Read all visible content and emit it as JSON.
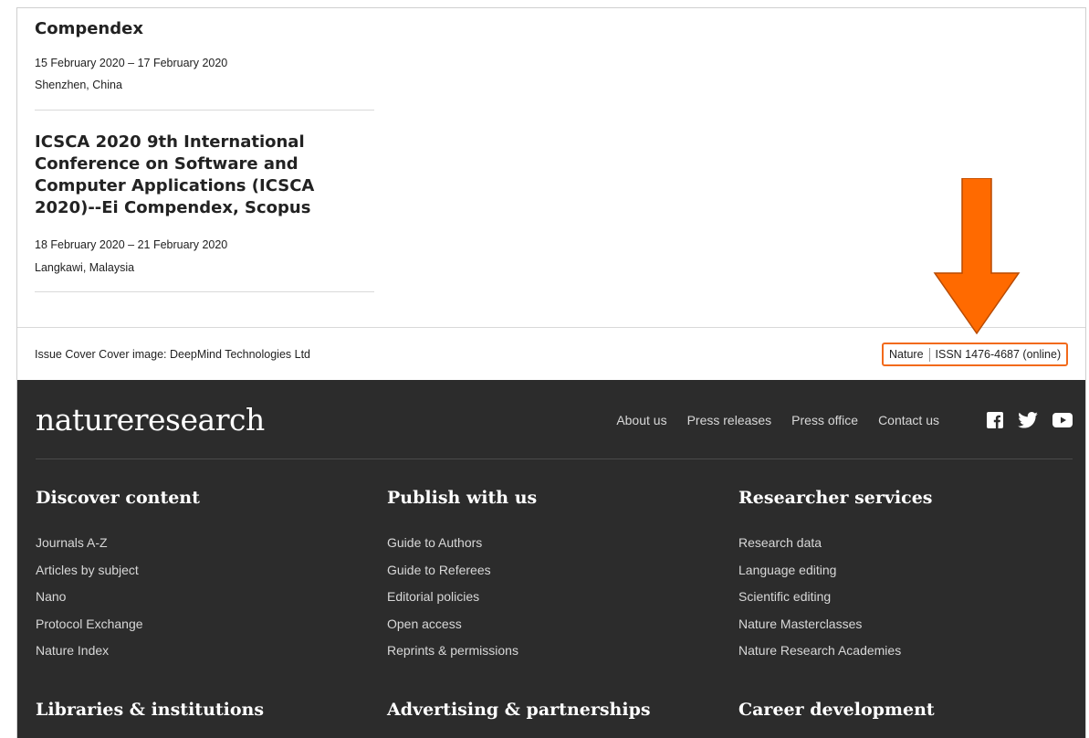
{
  "events": [
    {
      "title": "Compendex",
      "date": "15 February 2020 – 17 February 2020",
      "location": "Shenzhen, China"
    },
    {
      "title": "ICSCA 2020 9th International Conference on Software and Computer Applications (ICSCA 2020)--Ei Compendex, Scopus",
      "date": "18 February 2020 – 21 February 2020",
      "location": "Langkawi, Malaysia"
    }
  ],
  "cover_credit": "Issue Cover Cover image: DeepMind Technologies Ltd",
  "issn": {
    "journal": "Nature",
    "number": "ISSN 1476-4687 (online)",
    "highlight_color": "#f26a1b"
  },
  "footer": {
    "logo": "natureresearch",
    "nav": [
      "About us",
      "Press releases",
      "Press office",
      "Contact us"
    ],
    "social_icons": [
      "facebook-icon",
      "twitter-icon",
      "youtube-icon"
    ],
    "columns": [
      {
        "heading": "Discover content",
        "links": [
          "Journals A-Z",
          "Articles by subject",
          "Nano",
          "Protocol Exchange",
          "Nature Index"
        ]
      },
      {
        "heading": "Publish with us",
        "links": [
          "Guide to Authors",
          "Guide to Referees",
          "Editorial policies",
          "Open access",
          "Reprints & permissions"
        ]
      },
      {
        "heading": "Researcher services",
        "links": [
          "Research data",
          "Language editing",
          "Scientific editing",
          "Nature Masterclasses",
          "Nature Research Academies"
        ]
      }
    ],
    "next_headings": [
      "Libraries & institutions",
      "Advertising & partnerships",
      "Career development"
    ],
    "background": "#2c2c2c"
  },
  "annotation": {
    "arrow_color": "#ff6a00"
  }
}
